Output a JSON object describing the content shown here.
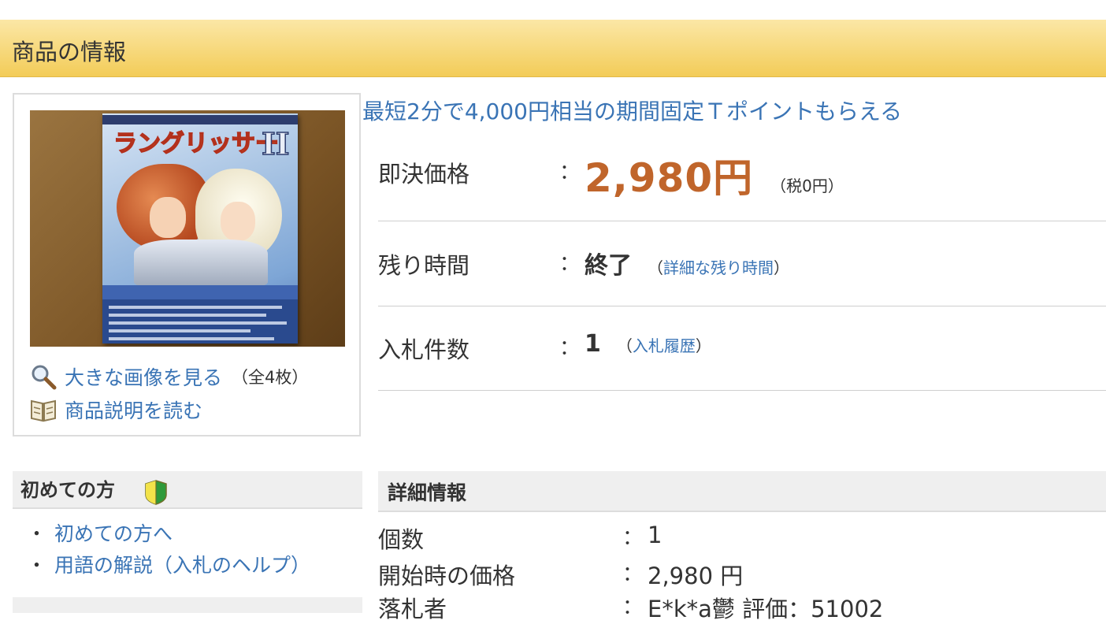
{
  "section": {
    "title": "商品の情報"
  },
  "image_panel": {
    "photo_label": "auction item photo",
    "cover_title": "ラングリッサーⅡ",
    "links": [
      {
        "label": "大きな画像を見る",
        "note": "（全4枚）",
        "icon": "magnifier-icon"
      },
      {
        "label": "商品説明を読む",
        "note": "",
        "icon": "book-icon"
      }
    ]
  },
  "promo": {
    "text": "最短2分で4,000円相当の期間固定Ｔポイントもらえる"
  },
  "info": {
    "buyout": {
      "label": "即決価格",
      "colon": "：",
      "price": "2,980円",
      "tax": "（税0円）"
    },
    "remaining": {
      "label": "残り時間",
      "colon": "：",
      "value": "終了",
      "paren_open": "（",
      "link": "詳細な残り時間",
      "paren_close": "）"
    },
    "bids": {
      "label": "入札件数",
      "colon": "：",
      "value": "1",
      "paren_open": "（",
      "link": "入札履歴",
      "paren_close": "）"
    }
  },
  "sidebar": {
    "title": "初めての方",
    "icon": "beginner-mark-icon",
    "links": [
      {
        "bullet": "・",
        "label": "初めての方へ"
      },
      {
        "bullet": "・",
        "label": "用語の解説（入札のヘルプ）"
      }
    ]
  },
  "details": {
    "title": "詳細情報",
    "rows": [
      {
        "label": "個数",
        "colon": "：",
        "value": "1"
      },
      {
        "label": "開始時の価格",
        "colon": "：",
        "value": "2,980 円"
      },
      {
        "label": "落札者",
        "colon": "：",
        "value": "E*k*a鬱 評価：51002"
      }
    ]
  },
  "colors": {
    "header_gradient_top": "#fbe7a6",
    "header_gradient_bottom": "#f3cc58",
    "link": "#3a74b5",
    "price": "#c0652b",
    "panel_gray": "#efefef"
  }
}
